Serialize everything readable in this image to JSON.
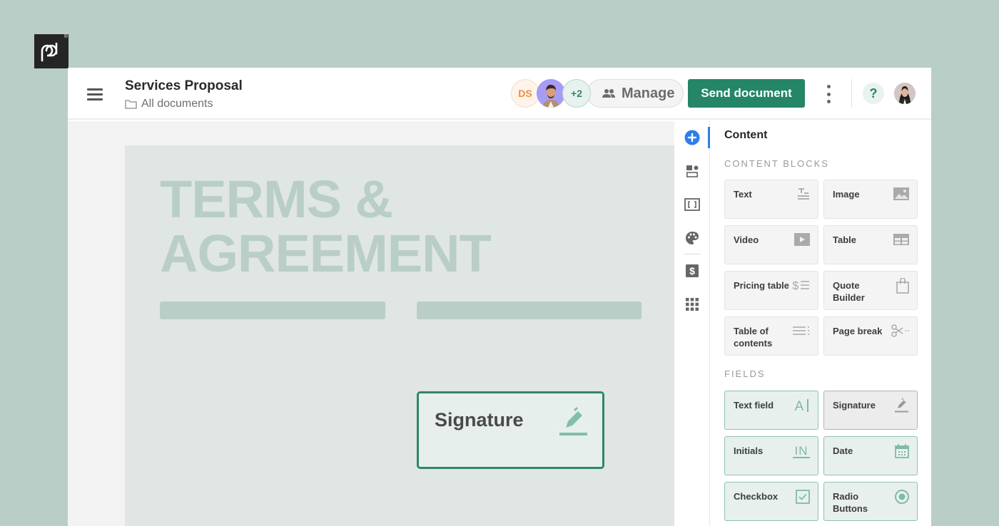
{
  "brand": {
    "logo_text": "pd",
    "registered_mark": "®"
  },
  "header": {
    "title": "Services Proposal",
    "breadcrumb": "All documents",
    "collaborators": {
      "initials": "DS",
      "more_count": "+2"
    },
    "manage_label": "Manage",
    "send_button": "Send document",
    "help_label": "?"
  },
  "document": {
    "title_line1": "TERMS &",
    "title_line2": "AGREEMENT",
    "signature_field_label": "Signature"
  },
  "rail": {
    "items": [
      {
        "name": "content",
        "icon": "plus-circle-icon",
        "active": true
      },
      {
        "name": "blocks",
        "icon": "layout-icon"
      },
      {
        "name": "embed",
        "icon": "brackets-icon"
      },
      {
        "name": "design",
        "icon": "palette-icon"
      },
      {
        "name": "pricing",
        "icon": "dollar-icon"
      },
      {
        "name": "apps",
        "icon": "grid-icon"
      }
    ]
  },
  "panel": {
    "title": "Content",
    "content_blocks_label": "CONTENT BLOCKS",
    "content_blocks": [
      {
        "label": "Text",
        "icon": "text-icon"
      },
      {
        "label": "Image",
        "icon": "image-icon"
      },
      {
        "label": "Video",
        "icon": "video-icon"
      },
      {
        "label": "Table",
        "icon": "table-icon"
      },
      {
        "label": "Pricing table",
        "icon": "pricing-table-icon"
      },
      {
        "label": "Quote Builder",
        "icon": "shopping-bag-icon"
      },
      {
        "label": "Table of contents",
        "icon": "toc-icon"
      },
      {
        "label": "Page break",
        "icon": "scissors-icon"
      }
    ],
    "fields_label": "FIELDS",
    "fields": [
      {
        "label": "Text field",
        "icon": "text-field-icon"
      },
      {
        "label": "Signature",
        "icon": "signature-pen-icon"
      },
      {
        "label": "Initials",
        "icon": "initials-icon",
        "glyph": "IN"
      },
      {
        "label": "Date",
        "icon": "calendar-icon"
      },
      {
        "label": "Checkbox",
        "icon": "checkbox-icon"
      },
      {
        "label": "Radio Buttons",
        "icon": "radio-icon"
      }
    ]
  },
  "colors": {
    "brand_green": "#248567",
    "accent_blue": "#2f7ee8",
    "field_green": "#8fc3ae",
    "background": "#b9cec6"
  }
}
